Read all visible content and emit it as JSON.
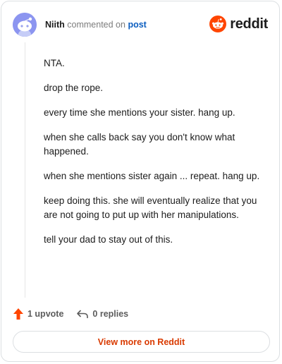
{
  "header": {
    "username": "Niith",
    "action_text": "commented on",
    "post_link": "post",
    "brand": "reddit"
  },
  "comment": {
    "paragraphs": [
      "NTA.",
      "drop the rope.",
      "every time she mentions your sister. hang up.",
      "when she calls back say you don't know what happened.",
      "when she mentions sister again ... repeat. hang up.",
      "keep doing this. she will eventually realize that you are not going to put up with her manipulations.",
      "tell your dad to stay out of this."
    ]
  },
  "footer": {
    "upvotes": "1 upvote",
    "replies": "0 replies"
  },
  "view_more": "View more on Reddit",
  "colors": {
    "brand": "#FF4500",
    "link": "#0A5DBF",
    "avatar": "#8C95F0"
  },
  "icons": {
    "avatar": "snoo-avatar-icon",
    "logo": "reddit-logo-icon",
    "upvote": "upvote-arrow-icon",
    "reply": "reply-arrow-icon"
  }
}
